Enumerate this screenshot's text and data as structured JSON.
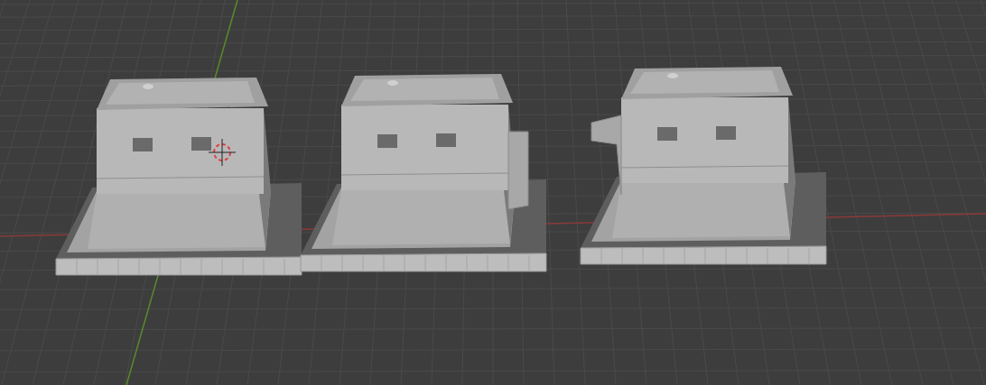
{
  "viewport": {
    "cursor_3d": true,
    "axes": true,
    "models": [
      {
        "kind": "plain"
      },
      {
        "kind": "side-box"
      },
      {
        "kind": "side-fin"
      }
    ]
  }
}
